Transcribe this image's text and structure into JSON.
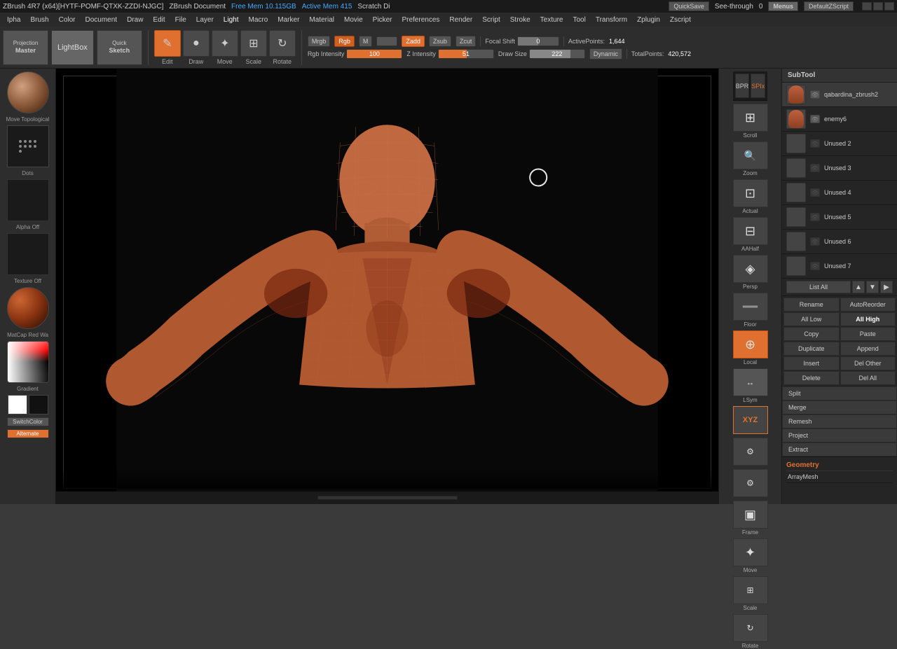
{
  "title_bar": {
    "brush": "ZBrush 4R7 (x64)[HYTF-POMF-QTXK-ZZDI-NJGC]",
    "document": "ZBrush Document",
    "mem_free": "Free Mem 10.115GB",
    "mem_active": "Active Mem 415",
    "scratch": "Scratch Di",
    "quicksave": "QuickSave",
    "see_through": "See-through",
    "see_through_val": "0",
    "menus": "Menus",
    "default_script": "DefaultZScript"
  },
  "menu_bar": {
    "items": [
      "Ipha",
      "Brush",
      "Color",
      "Document",
      "Draw",
      "Edit",
      "File",
      "Layer",
      "Light",
      "Macro",
      "Marker",
      "Material",
      "Movie",
      "Picker",
      "Preferences",
      "Render",
      "Script",
      "Stroke",
      "Texture",
      "Tool",
      "Transform",
      "Zplugin",
      "Zscript"
    ]
  },
  "toolbar": {
    "projection_master": "Projection Master",
    "projection_top": "Projection",
    "projection_bottom": "Master",
    "lightbox": "LightBox",
    "quick_sketch_top": "Quick",
    "quick_sketch_bottom": "Sketch",
    "mrgb": "Mrgb",
    "rgb": "Rgb",
    "m_toggle": "M",
    "zadd": "Zadd",
    "zsub": "Zsub",
    "zcut": "Zcut",
    "focal_label": "Focal Shift",
    "focal_value": "0",
    "active_points_label": "ActivePoints:",
    "active_points_value": "1,644",
    "edit_label": "Edit",
    "draw_label": "Draw",
    "move_label": "Move",
    "scale_label": "Scale",
    "rotate_label": "Rotate",
    "rgb_intensity_label": "Rgb Intensity",
    "rgb_intensity_value": "100",
    "z_intensity_label": "Z Intensity",
    "z_intensity_value": "51",
    "draw_size_label": "Draw Size",
    "draw_size_value": "222",
    "dynamic_label": "Dynamic",
    "total_points_label": "TotalPoints:",
    "total_points_value": "420,572"
  },
  "left_panel": {
    "move_topological": "Move Topological",
    "dots_label": "Dots",
    "alpha_label": "Alpha  Off",
    "texture_label": "Texture  Off",
    "matcap_label": "MatCap Red Wa",
    "gradient_label": "Gradient",
    "switch_color": "SwitchColor",
    "alternate": "Alternate"
  },
  "right_panel": {
    "buttons": [
      {
        "label": "SPIx",
        "icon": "◫"
      },
      {
        "label": "Scroll",
        "icon": "⊞"
      },
      {
        "label": "Zoom",
        "icon": "🔍"
      },
      {
        "label": "Actual",
        "icon": "⊡"
      },
      {
        "label": "AAHalf",
        "icon": "⊟"
      },
      {
        "label": "Persp",
        "icon": "◈"
      },
      {
        "label": "Floor",
        "icon": "═"
      },
      {
        "label": "Local",
        "icon": "⊕"
      },
      {
        "label": "LSym",
        "icon": "↔"
      },
      {
        "label": "",
        "icon": "XYZ"
      },
      {
        "label": "",
        "icon": "⚙"
      },
      {
        "label": "",
        "icon": "⚙"
      },
      {
        "label": "Frame",
        "icon": "▣"
      },
      {
        "label": "Move",
        "icon": "✦"
      },
      {
        "label": "Scale",
        "icon": "⊞"
      },
      {
        "label": "Rotate",
        "icon": "↻"
      }
    ]
  },
  "subtool_panel": {
    "header": "SubTool",
    "items": [
      {
        "name": "qabardina_zbrush2",
        "visible": true,
        "active": true
      },
      {
        "name": "enemy6",
        "visible": true,
        "active": false
      },
      {
        "name": "Unused 2",
        "visible": false,
        "active": false
      },
      {
        "name": "Unused 3",
        "visible": false,
        "active": false
      },
      {
        "name": "Unused 4",
        "visible": false,
        "active": false
      },
      {
        "name": "Unused 5",
        "visible": false,
        "active": false
      },
      {
        "name": "Unused 6",
        "visible": false,
        "active": false
      },
      {
        "name": "Unused 7",
        "visible": false,
        "active": false
      }
    ],
    "list_all": "List All",
    "actions": {
      "rename": "Rename",
      "auto_reorder": "AutoReorder",
      "all_low": "All Low",
      "all_high": "All High",
      "copy": "Copy",
      "paste": "Paste",
      "duplicate": "Duplicate",
      "append": "Append",
      "insert": "Insert",
      "del_other": "Del Other",
      "delete": "Delete",
      "del_all": "Del All",
      "split": "Split",
      "merge": "Merge",
      "remesh": "Remesh",
      "project": "Project",
      "extract": "Extract"
    },
    "geometry": {
      "header": "Geometry",
      "items": [
        "ArrayMesh"
      ]
    }
  },
  "canvas": {
    "cursor_visible": true
  },
  "colors": {
    "orange": "#e07030",
    "dark_bg": "#1a1a1a",
    "panel_bg": "#2d2d2d",
    "subtool_bg": "#252525",
    "active_blue": "#e07030",
    "text_dim": "#999",
    "text_normal": "#ccc",
    "text_bright": "#fff"
  }
}
